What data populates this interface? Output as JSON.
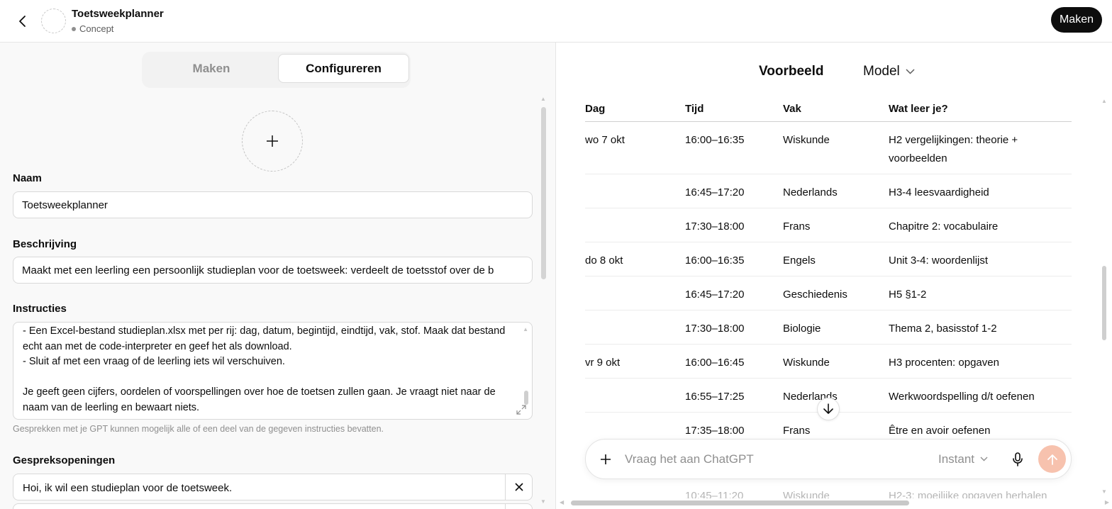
{
  "header": {
    "title": "Toetsweekplanner",
    "status": "Concept",
    "make_button": "Maken"
  },
  "tabs": [
    {
      "label": "Maken",
      "active": false
    },
    {
      "label": "Configureren",
      "active": true
    }
  ],
  "form": {
    "name_label": "Naam",
    "name_value": "Toetsweekplanner",
    "description_label": "Beschrijving",
    "description_value": "Maakt met een leerling een persoonlijk studieplan voor de toetsweek: verdeelt de toetsstof over de b",
    "instructions_label": "Instructies",
    "instructions_value": "- Een Excel-bestand studieplan.xlsx met per rij: dag, datum, begintijd, eindtijd, vak, stof. Maak dat bestand echt aan met de code-interpreter en geef het als download.\n- Sluit af met een vraag of de leerling iets wil verschuiven.\n\nJe geeft geen cijfers, oordelen of voorspellingen over hoe de toetsen zullen gaan. Je vraagt niet naar de naam van de leerling en bewaart niets.",
    "instructions_hint": "Gesprekken met je GPT kunnen mogelijk alle of een deel van de gegeven instructies bevatten.",
    "starters_label": "Gespreksopeningen",
    "starters": [
      "Hoi, ik wil een studieplan voor de toetsweek."
    ]
  },
  "preview": {
    "title": "Voorbeeld",
    "model_label": "Model",
    "table": {
      "headers": [
        "Dag",
        "Tijd",
        "Vak",
        "Wat leer je?"
      ],
      "rows": [
        {
          "dag": "wo 7 okt",
          "tijd": "16:00–16:35",
          "vak": "Wiskunde",
          "wat": "H2 vergelijkingen: theorie + voorbeelden"
        },
        {
          "dag": "",
          "tijd": "16:45–17:20",
          "vak": "Nederlands",
          "wat": "H3-4 leesvaardigheid"
        },
        {
          "dag": "",
          "tijd": "17:30–18:00",
          "vak": "Frans",
          "wat": "Chapitre 2: vocabulaire"
        },
        {
          "dag": "do 8 okt",
          "tijd": "16:00–16:35",
          "vak": "Engels",
          "wat": "Unit 3-4: woordenlijst"
        },
        {
          "dag": "",
          "tijd": "16:45–17:20",
          "vak": "Geschiedenis",
          "wat": "H5 §1-2"
        },
        {
          "dag": "",
          "tijd": "17:30–18:00",
          "vak": "Biologie",
          "wat": "Thema 2, basisstof 1-2"
        },
        {
          "dag": "vr 9 okt",
          "tijd": "16:00–16:45",
          "vak": "Wiskunde",
          "wat": "H3 procenten: opgaven"
        },
        {
          "dag": "",
          "tijd": "16:55–17:25",
          "vak": "Nederlands",
          "wat": "Werkwoordspelling d/t oefenen"
        },
        {
          "dag": "",
          "tijd": "17:35–18:00",
          "vak": "Frans",
          "wat": "Être en avoir oefenen"
        }
      ],
      "partial_row": {
        "tijd": "10:45–11:20",
        "vak": "Wiskunde",
        "wat": "H2-3: moeilijke opgaven herhalen"
      }
    },
    "composer": {
      "placeholder": "Vraag het aan ChatGPT",
      "mode": "Instant"
    }
  },
  "colors": {
    "accent_dark": "#0d0d0d",
    "send_button": "#f7c2ae"
  }
}
